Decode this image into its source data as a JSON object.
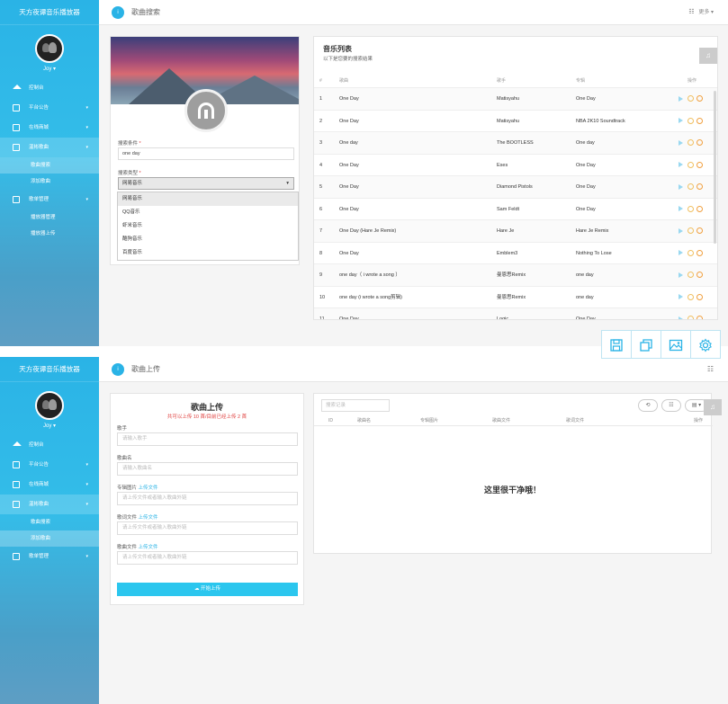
{
  "app": {
    "brand": "天方夜谭音乐播放器",
    "user": "Joy ▾"
  },
  "sidebar1": {
    "items": [
      {
        "label": "控制台",
        "icon": "home-icon"
      },
      {
        "label": "平台公告",
        "icon": "notice-icon",
        "caret": "▾"
      },
      {
        "label": "在线商城",
        "icon": "shop-icon",
        "caret": "▾"
      },
      {
        "label": "温彬歌曲",
        "icon": "folder-icon",
        "caret": "▾"
      }
    ],
    "sub_a": [
      "歌曲搜索",
      "添加歌曲"
    ],
    "item5": {
      "label": "歌单管理",
      "icon": "playlist-icon",
      "caret": "▾"
    },
    "sub_b": [
      "播放器管理",
      "播放器上传"
    ]
  },
  "sidebar2": {
    "items": [
      {
        "label": "控制台",
        "icon": "home-icon"
      },
      {
        "label": "平台公告",
        "icon": "notice-icon",
        "caret": "▾"
      },
      {
        "label": "在线商城",
        "icon": "shop-icon",
        "caret": "▾"
      },
      {
        "label": "温彬歌曲",
        "icon": "folder-icon",
        "caret": "▾"
      }
    ],
    "sub_a": [
      "歌曲搜索",
      "添加歌曲"
    ],
    "item5": {
      "label": "歌单管理",
      "icon": "playlist-icon",
      "caret": "▾"
    }
  },
  "header1": {
    "badge": "i",
    "title": "歌曲搜索",
    "more": "更多 ▾",
    "grid_icon": "☷"
  },
  "header2": {
    "badge": "i",
    "title": "歌曲上传",
    "grid_icon": "☷"
  },
  "search": {
    "keyword_label": "搜索条件",
    "keyword_value": "one day",
    "type_label": "搜索类型",
    "type_value": "网易音乐",
    "caret": "▾",
    "required_mark": "*",
    "options": [
      "网易音乐",
      "QQ音乐",
      "虾米音乐",
      "酷狗音乐",
      "百度音乐"
    ]
  },
  "music_list": {
    "title": "音乐列表",
    "subtitle": "以下是您要的搜索结果",
    "side_icon": "♫",
    "columns": [
      "#",
      "歌曲",
      "歌手",
      "专辑",
      "操作"
    ],
    "rows": [
      {
        "num": "1",
        "name": "One Day",
        "artist": "Matisyahu",
        "album": "One Day"
      },
      {
        "num": "2",
        "name": "One Day",
        "artist": "Matisyahu",
        "album": "NBA 2K10 Soundtrack"
      },
      {
        "num": "3",
        "name": "One day",
        "artist": "The BOOTLESS",
        "album": "One day"
      },
      {
        "num": "4",
        "name": "One Day",
        "artist": "Eses",
        "album": "One Day"
      },
      {
        "num": "5",
        "name": "One Day",
        "artist": "Diamond Pistols",
        "album": "One Day"
      },
      {
        "num": "6",
        "name": "One Day",
        "artist": "Sam Feldt",
        "album": "One Day"
      },
      {
        "num": "7",
        "name": "One Day (Hare Je Remix)",
        "artist": "Hare Je",
        "album": "Hare Je Remix"
      },
      {
        "num": "8",
        "name": "One Day",
        "artist": "Emblem3",
        "album": "Nothing To Lose"
      },
      {
        "num": "9",
        "name": "one day（ i wrote a song ）",
        "artist": "曼恩思Remix",
        "album": "one day"
      },
      {
        "num": "10",
        "name": "one day (i wrote a song剪辑)",
        "artist": "曼恩思Remix",
        "album": "one day"
      },
      {
        "num": "11",
        "name": "One Day",
        "artist": "Logic",
        "album": "One Day"
      }
    ]
  },
  "upload": {
    "title": "歌曲上传",
    "notice": "共可以上传 10 首/目前已经上传 2 首",
    "fields": [
      {
        "label": "歌手",
        "link": "",
        "placeholder": "请输入歌手"
      },
      {
        "label": "歌曲名",
        "link": "",
        "placeholder": "请输入歌曲名"
      },
      {
        "label": "专辑图片",
        "link": "上传文件",
        "placeholder": "请上传文件或者输入歌曲外链"
      },
      {
        "label": "歌词文件",
        "link": "上传文件",
        "placeholder": "请上传文件或者输入歌曲外链"
      },
      {
        "label": "歌曲文件",
        "link": "上传文件",
        "placeholder": "请上传文件或者输入歌曲外链"
      }
    ],
    "button": "☁ 开始上传"
  },
  "records": {
    "search_placeholder": "搜索记录",
    "buttons": [
      "⟲",
      "☷",
      "▤ ▾"
    ],
    "columns": [
      "ID",
      "歌曲名",
      "专辑图片",
      "歌曲文件",
      "歌词文件",
      "操作"
    ],
    "empty_text": "这里很干净哦！",
    "side_icon": "♫"
  }
}
